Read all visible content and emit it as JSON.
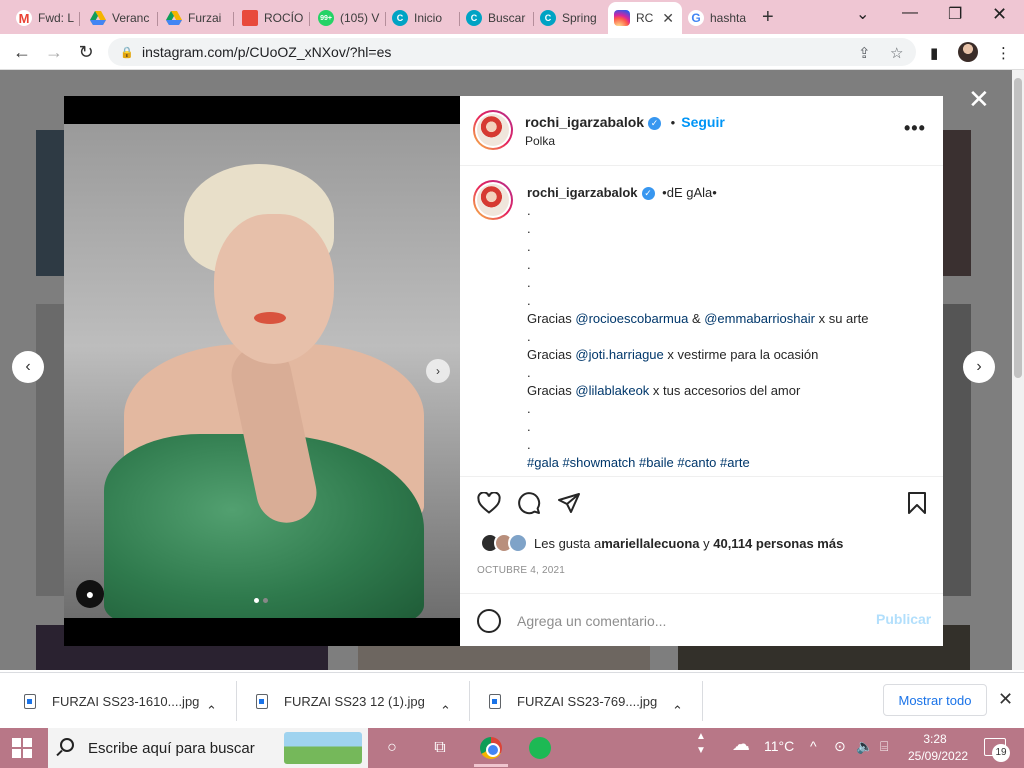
{
  "browser": {
    "tabs": [
      {
        "label": "Fwd: L",
        "icon": "gmail-icon",
        "color": "#ea4335"
      },
      {
        "label": "Veranc",
        "icon": "google-drive-icon",
        "color": "#f4b400"
      },
      {
        "label": "Furzai",
        "icon": "google-drive-icon",
        "color": "#0f9d58"
      },
      {
        "label": "ROCÍO",
        "icon": "google-slides-icon",
        "color": "#e84a3b"
      },
      {
        "label": "(105) V",
        "icon": "whatsapp-icon",
        "color": "#25d366",
        "badge": "99+"
      },
      {
        "label": "Inicio",
        "icon": "canva-icon",
        "color": "#00a3c4"
      },
      {
        "label": "Buscar",
        "icon": "canva-icon",
        "color": "#00a3c4"
      },
      {
        "label": "Spring",
        "icon": "canva-icon",
        "color": "#00a3c4"
      },
      {
        "label": "RC",
        "icon": "instagram-icon",
        "color": "#e1306c",
        "active": true
      },
      {
        "label": "hashta",
        "icon": "google-icon",
        "color": "#4285f4"
      }
    ],
    "url": "instagram.com/p/CUoOZ_xNXov/?hl=es"
  },
  "post": {
    "username": "rochi_igarzabalok",
    "follow_label": "Seguir",
    "separator": "•",
    "location": "Polka",
    "caption_title": "•dE gAla•",
    "dot": ".",
    "thanks1_pre": "Gracias ",
    "thanks1_m1": "@rocioescobarmua",
    "thanks1_and": " & ",
    "thanks1_m2": "@emmabarrioshair",
    "thanks1_post": " x su arte",
    "thanks2_pre": "Gracias ",
    "thanks2_m": "@joti.harriague",
    "thanks2_post": " x vestirme para la ocasión",
    "thanks3_pre": "Gracias ",
    "thanks3_m": "@lilablakeok",
    "thanks3_post": " x tus accesorios del amor",
    "hashtags": [
      "#gala",
      "#showmatch",
      "#baile",
      "#canto",
      "#arte"
    ],
    "likes_pre": "Les gusta a ",
    "likes_user": "mariellalecuona",
    "likes_mid": " y ",
    "likes_count": "40,114 personas más",
    "date": "OCTUBRE 4, 2021",
    "comment_placeholder": "Agrega un comentario...",
    "publish_label": "Publicar"
  },
  "downloads": {
    "items": [
      "FURZAI SS23-1610....jpg",
      "FURZAI SS23 12 (1).jpg",
      "FURZAI SS23-769....jpg"
    ],
    "show_all": "Mostrar todo"
  },
  "taskbar": {
    "search_placeholder": "Escribe aquí para buscar",
    "weather": "11°C",
    "time": "3:28",
    "date": "25/09/2022",
    "notifications": "19"
  }
}
